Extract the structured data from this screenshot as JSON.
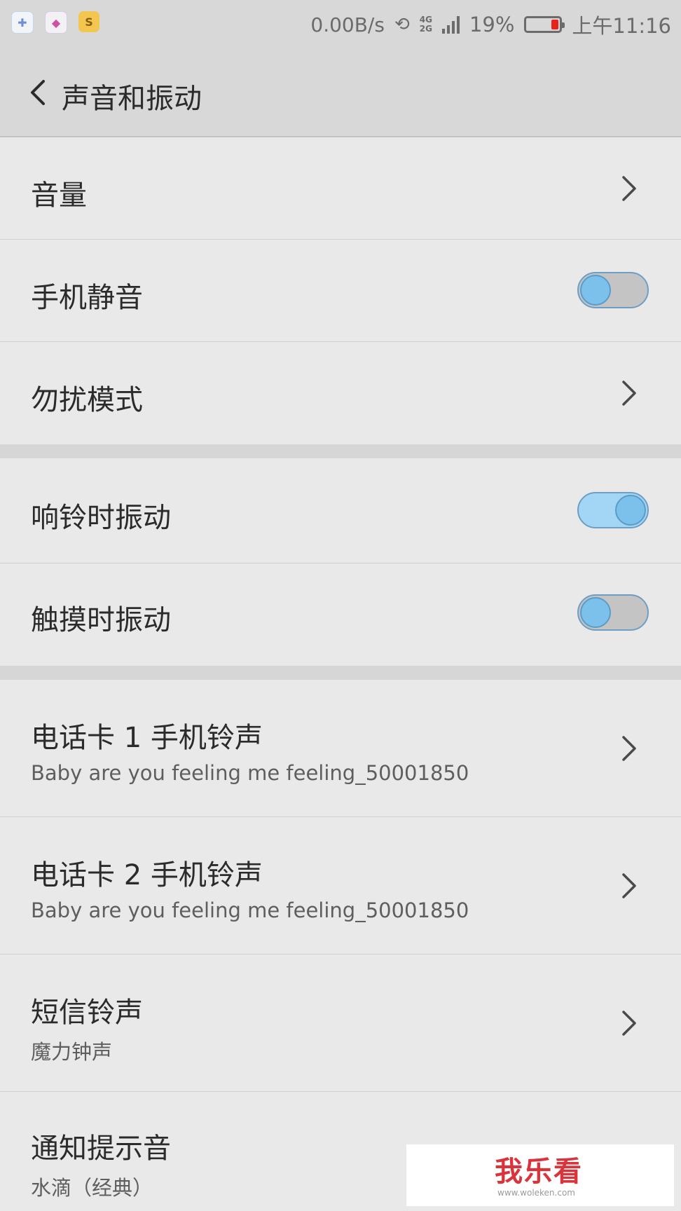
{
  "status_bar": {
    "app_icons": [
      "shield-plus-icon",
      "colorful-ball-icon",
      "s-app-icon"
    ],
    "net_speed": "0.00B/s",
    "network_4g": "4G",
    "network_2g": "2G",
    "battery_percent": "19%",
    "battery_level": 0.19,
    "battery_level_color": "#e8231c",
    "time": "上午11:16"
  },
  "header": {
    "title": "声音和振动",
    "back_icon": "chevron-left-icon"
  },
  "settings": {
    "volume": {
      "label": "音量"
    },
    "silent": {
      "label": "手机静音",
      "on": false
    },
    "dnd": {
      "label": "勿扰模式"
    },
    "vibrate_ring": {
      "label": "响铃时振动",
      "on": true
    },
    "vibrate_touch": {
      "label": "触摸时振动",
      "on": false
    },
    "sim1_ringtone": {
      "label": "电话卡 1 手机铃声",
      "value": "Baby are you feeling me feeling_50001850"
    },
    "sim2_ringtone": {
      "label": "电话卡 2 手机铃声",
      "value": "Baby are you feeling me feeling_50001850"
    },
    "sms_ringtone": {
      "label": "短信铃声",
      "value": "魔力钟声"
    },
    "notification_sound": {
      "label": "通知提示音",
      "value": "水滴（经典）"
    }
  },
  "watermark": {
    "text": "我乐看",
    "url": "www.woleken.com"
  },
  "colors": {
    "background": "#e9e9e9",
    "bar": "#d8d8d8",
    "toggle_knob": "#7cc0ec",
    "toggle_on_track": "#a3d6f5",
    "toggle_off_track": "#c4c4c4",
    "watermark_red": "#d9343b"
  }
}
